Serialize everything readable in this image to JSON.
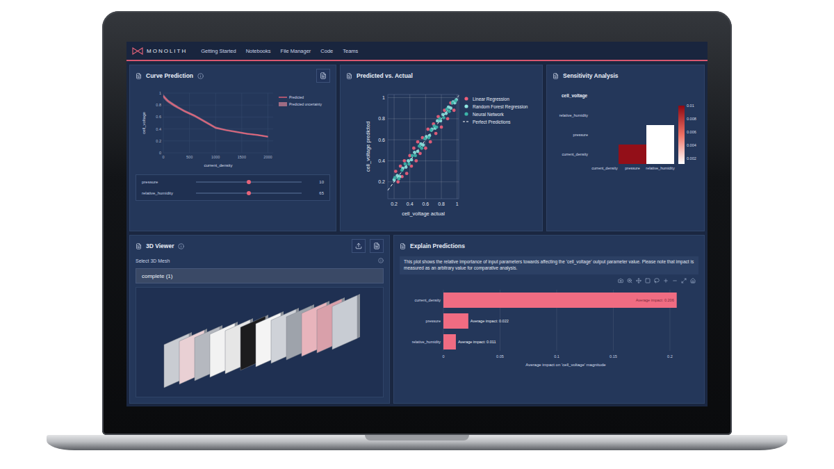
{
  "brand": "MONOLITH",
  "nav": [
    "Getting Started",
    "Notebooks",
    "File Manager",
    "Code",
    "Teams"
  ],
  "curve_prediction": {
    "title": "Curve Prediction",
    "y_label": "cell_voltage",
    "x_label": "current_density",
    "x_ticks": [
      "0",
      "500",
      "1000",
      "1500",
      "2000"
    ],
    "y_ticks": [
      "0",
      "0.2",
      "0.4",
      "0.6",
      "0.8",
      "1"
    ],
    "legend": [
      {
        "label": "Predicted",
        "color": "#e8647a"
      },
      {
        "label": "Predicted uncertainty",
        "color": "#f0909f"
      }
    ],
    "series": {
      "x": [
        0,
        50,
        100,
        200,
        300,
        400,
        500,
        600,
        700,
        800,
        900,
        1000,
        1200,
        1400,
        1600,
        1800,
        2000
      ],
      "predicted": [
        0.95,
        0.9,
        0.86,
        0.8,
        0.75,
        0.7,
        0.66,
        0.62,
        0.57,
        0.52,
        0.47,
        0.42,
        0.38,
        0.35,
        0.32,
        0.3,
        0.27
      ],
      "uncertainty": [
        0.03,
        0.03,
        0.025,
        0.025,
        0.02,
        0.02,
        0.02,
        0.02,
        0.02,
        0.02,
        0.02,
        0.02,
        0.015,
        0.015,
        0.015,
        0.015,
        0.015
      ]
    },
    "sliders": [
      {
        "name": "pressure",
        "value": "10",
        "level": 0.5
      },
      {
        "name": "relative_humidity",
        "value": "65",
        "level": 0.5
      }
    ]
  },
  "predicted_vs_actual": {
    "title": "Predicted vs. Actual",
    "y_label": "cell_voltage predicted",
    "x_label": "cell_voltage actual",
    "x_ticks": [
      "0.2",
      "0.4",
      "0.6",
      "0.8",
      "1"
    ],
    "y_ticks": [
      "0.2",
      "0.4",
      "0.6",
      "0.8",
      "1"
    ],
    "series": [
      {
        "label": "Linear Regression",
        "kind": "points",
        "color": "#ef5f7a",
        "points": [
          [
            0.22,
            0.3
          ],
          [
            0.25,
            0.2
          ],
          [
            0.28,
            0.35
          ],
          [
            0.3,
            0.25
          ],
          [
            0.33,
            0.4
          ],
          [
            0.36,
            0.28
          ],
          [
            0.4,
            0.45
          ],
          [
            0.42,
            0.35
          ],
          [
            0.45,
            0.52
          ],
          [
            0.48,
            0.4
          ],
          [
            0.5,
            0.58
          ],
          [
            0.53,
            0.47
          ],
          [
            0.56,
            0.62
          ],
          [
            0.6,
            0.52
          ],
          [
            0.63,
            0.7
          ],
          [
            0.66,
            0.58
          ],
          [
            0.7,
            0.75
          ],
          [
            0.73,
            0.66
          ],
          [
            0.76,
            0.82
          ],
          [
            0.8,
            0.72
          ],
          [
            0.84,
            0.88
          ],
          [
            0.88,
            0.8
          ],
          [
            0.92,
            0.95
          ],
          [
            0.96,
            0.88
          ]
        ]
      },
      {
        "label": "Random Forest Regression",
        "kind": "points",
        "color": "#8ee6e0",
        "points": [
          [
            0.2,
            0.22
          ],
          [
            0.24,
            0.26
          ],
          [
            0.27,
            0.25
          ],
          [
            0.31,
            0.33
          ],
          [
            0.35,
            0.34
          ],
          [
            0.38,
            0.4
          ],
          [
            0.42,
            0.41
          ],
          [
            0.46,
            0.48
          ],
          [
            0.5,
            0.49
          ],
          [
            0.54,
            0.56
          ],
          [
            0.57,
            0.55
          ],
          [
            0.61,
            0.63
          ],
          [
            0.65,
            0.64
          ],
          [
            0.68,
            0.7
          ],
          [
            0.72,
            0.71
          ],
          [
            0.75,
            0.78
          ],
          [
            0.79,
            0.78
          ],
          [
            0.82,
            0.84
          ],
          [
            0.86,
            0.85
          ],
          [
            0.89,
            0.91
          ],
          [
            0.92,
            0.9
          ],
          [
            0.95,
            0.96
          ],
          [
            0.97,
            0.95
          ],
          [
            0.99,
            0.98
          ]
        ]
      },
      {
        "label": "Neural Network",
        "kind": "points",
        "color": "#3cb4a8",
        "points": [
          [
            0.21,
            0.24
          ],
          [
            0.26,
            0.23
          ],
          [
            0.3,
            0.31
          ],
          [
            0.34,
            0.37
          ],
          [
            0.39,
            0.37
          ],
          [
            0.43,
            0.45
          ],
          [
            0.47,
            0.45
          ],
          [
            0.52,
            0.54
          ],
          [
            0.55,
            0.52
          ],
          [
            0.59,
            0.61
          ],
          [
            0.64,
            0.62
          ],
          [
            0.67,
            0.69
          ],
          [
            0.71,
            0.73
          ],
          [
            0.74,
            0.72
          ],
          [
            0.78,
            0.8
          ],
          [
            0.83,
            0.81
          ],
          [
            0.87,
            0.89
          ],
          [
            0.9,
            0.87
          ],
          [
            0.94,
            0.95
          ],
          [
            0.98,
            0.97
          ]
        ]
      },
      {
        "label": "Perfect Predictions",
        "kind": "line",
        "color": "#ffffff",
        "points": [
          [
            0.12,
            0.12
          ],
          [
            1.02,
            1.02
          ]
        ]
      }
    ]
  },
  "sensitivity": {
    "title": "Sensitivity Analysis",
    "subtitle": "cell_voltage",
    "x_labels": [
      "current_density",
      "pressure",
      "relative_humidity"
    ],
    "y_labels": [
      "relative_humidity",
      "pressure",
      "current_density"
    ],
    "cells": [
      {
        "x": "pressure",
        "y": "current_density",
        "value": 0.0097
      },
      {
        "x": "relative_humidity",
        "y": "current_density",
        "value": 0.0012
      },
      {
        "x": "relative_humidity",
        "y": "pressure",
        "value": 0.0012
      }
    ],
    "colorbar_ticks": [
      "0.002",
      "0.004",
      "0.006",
      "0.008",
      "0.01"
    ]
  },
  "viewer": {
    "title": "3D Viewer",
    "select_label": "Select 3D Mesh",
    "mesh": "complete (1)"
  },
  "explain": {
    "title": "Explain Predictions",
    "description": "This plot shows the relative importance of input parameters towards affecting the 'cell_voltage' output parameter value. Please note that impact is measured as an arbitrary value for comparative analysis.",
    "bars": [
      {
        "label": "current_density",
        "value": 0.206,
        "text": "Average impact: 0.206"
      },
      {
        "label": "pressure",
        "value": 0.022,
        "text": "Average impact: 0.022"
      },
      {
        "label": "relative_humidity",
        "value": 0.011,
        "text": "Average impact: 0.011"
      }
    ],
    "x_ticks": [
      "0",
      "0.05",
      "0.1",
      "0.15",
      "0.2"
    ],
    "x_label": "Average impact on 'cell_voltage' magnitude"
  }
}
